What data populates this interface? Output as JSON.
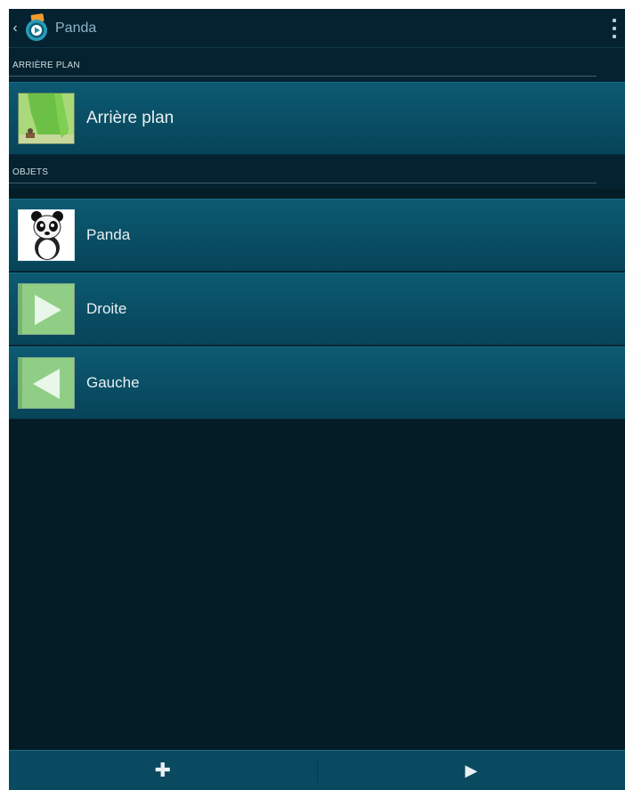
{
  "actionbar": {
    "back_glyph": "‹",
    "title": "Panda",
    "icons": {
      "back": "chevron-left-icon",
      "app": "app-logo-icon",
      "overflow": "overflow-menu-icon"
    }
  },
  "sections": {
    "background_header": "ARRIÈRE PLAN",
    "objects_header": "OBJETS"
  },
  "background_item": {
    "label": "Arrière plan",
    "icon": "landscape-thumbnail"
  },
  "objects": [
    {
      "label": "Panda",
      "icon": "panda-thumbnail"
    },
    {
      "label": "Droite",
      "icon": "play-right-thumbnail"
    },
    {
      "label": "Gauche",
      "icon": "play-left-thumbnail"
    }
  ],
  "bottombar": {
    "add_glyph": "✚",
    "play_glyph": "▶",
    "icons": {
      "add": "plus-icon",
      "play": "play-icon"
    }
  },
  "colors": {
    "screen_bg": "#041c26",
    "item_top": "#0c5a72",
    "item_bottom": "#074459",
    "thumb_green": "#8fce84",
    "arrow_white": "#e9f6ea"
  }
}
